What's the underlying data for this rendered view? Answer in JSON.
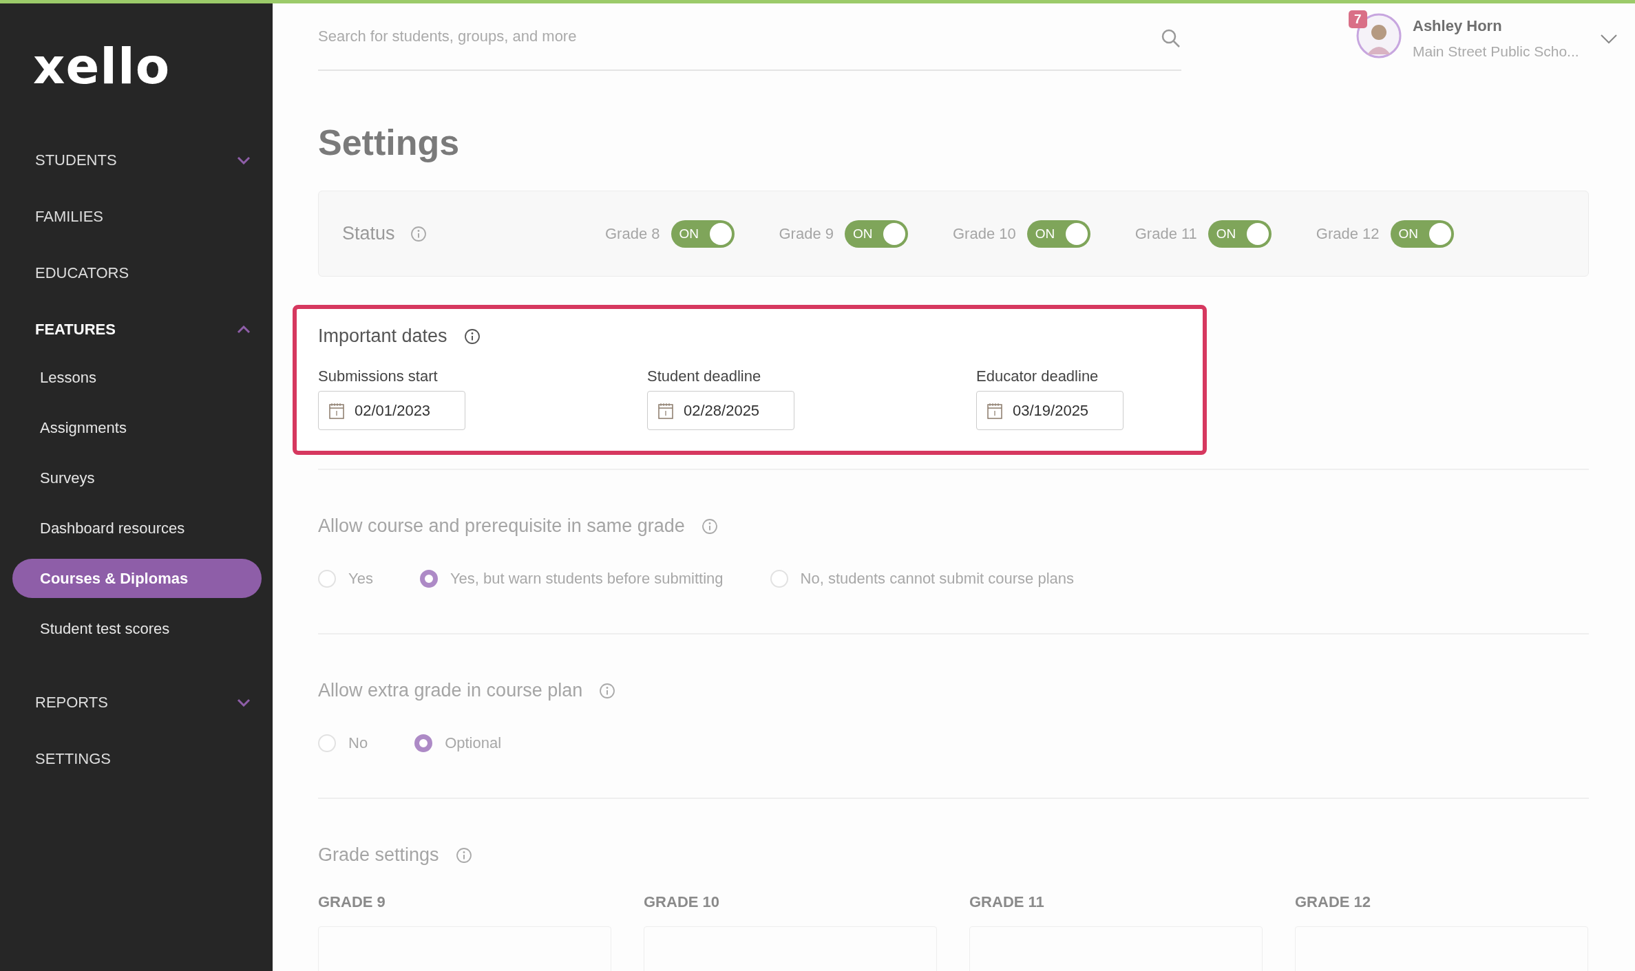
{
  "logo": "xello",
  "sidebar": {
    "items": [
      {
        "label": "STUDENTS",
        "expanded": false
      },
      {
        "label": "FAMILIES"
      },
      {
        "label": "EDUCATORS"
      },
      {
        "label": "FEATURES",
        "expanded": true,
        "children": [
          {
            "label": "Lessons",
            "selected": false
          },
          {
            "label": "Assignments",
            "selected": false
          },
          {
            "label": "Surveys",
            "selected": false
          },
          {
            "label": "Dashboard resources",
            "selected": false
          },
          {
            "label": "Courses & Diplomas",
            "selected": true
          },
          {
            "label": "Student test scores",
            "selected": false
          }
        ]
      },
      {
        "label": "REPORTS",
        "expanded": false
      },
      {
        "label": "SETTINGS"
      }
    ]
  },
  "header": {
    "search": {
      "placeholder": "Search for students, groups, and more"
    },
    "user": {
      "notifications": "7",
      "name": "Ashley Horn",
      "school": "Main Street Public Scho..."
    }
  },
  "title": "Settings",
  "status": {
    "label": "Status",
    "toggles": [
      {
        "label": "Grade 8",
        "on": true,
        "text": "ON"
      },
      {
        "label": "Grade 9",
        "on": true,
        "text": "ON"
      },
      {
        "label": "Grade 10",
        "on": true,
        "text": "ON"
      },
      {
        "label": "Grade 11",
        "on": true,
        "text": "ON"
      },
      {
        "label": "Grade 12",
        "on": true,
        "text": "ON"
      }
    ]
  },
  "important_dates": {
    "title": "Important dates",
    "highlighted": true,
    "fields": [
      {
        "label": "Submissions start",
        "value": "02/01/2023"
      },
      {
        "label": "Student deadline",
        "value": "02/28/2025"
      },
      {
        "label": "Educator deadline",
        "value": "03/19/2025"
      }
    ]
  },
  "course_prerequisite": {
    "title": "Allow course and prerequisite in same grade",
    "options": [
      {
        "label": "Yes",
        "selected": false
      },
      {
        "label": "Yes, but warn students before submitting",
        "selected": true
      },
      {
        "label": "No, students cannot submit course plans",
        "selected": false
      }
    ]
  },
  "extra_grade": {
    "title": "Allow extra grade in course plan",
    "options": [
      {
        "label": "No",
        "selected": false
      },
      {
        "label": "Optional",
        "selected": true
      }
    ]
  },
  "grade_settings": {
    "title": "Grade settings",
    "columns": [
      {
        "label": "GRADE 9"
      },
      {
        "label": "GRADE 10"
      },
      {
        "label": "GRADE 11"
      },
      {
        "label": "GRADE 12"
      }
    ]
  }
}
